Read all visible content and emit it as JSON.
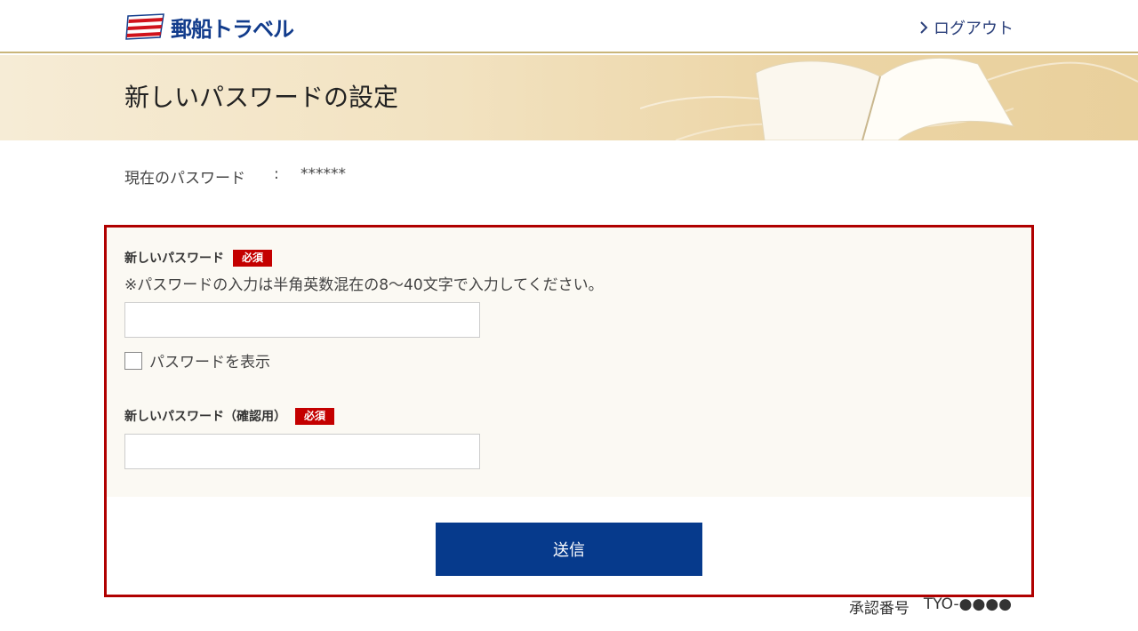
{
  "header": {
    "brand": "郵船トラベル",
    "logout_label": "ログアウト"
  },
  "banner": {
    "title": "新しいパスワードの設定"
  },
  "current_password": {
    "label": "現在のパスワード",
    "separator": ":",
    "value": "******"
  },
  "form": {
    "new_password": {
      "label": "新しいパスワード",
      "required_badge": "必須",
      "note": "※パスワードの入力は半角英数混在の8～40文字で入力してください。",
      "value": ""
    },
    "show_password": {
      "label": "パスワードを表示",
      "checked": false
    },
    "confirm_password": {
      "label": "新しいパスワード（確認用）",
      "required_badge": "必須",
      "value": ""
    },
    "submit_label": "送信"
  },
  "approval": {
    "label": "承認番号",
    "value": "TYO-●●●●"
  },
  "colors": {
    "brand_blue": "#063a8c",
    "required_red": "#c40000",
    "form_border": "#b00000",
    "form_background": "#fbf9f3"
  }
}
